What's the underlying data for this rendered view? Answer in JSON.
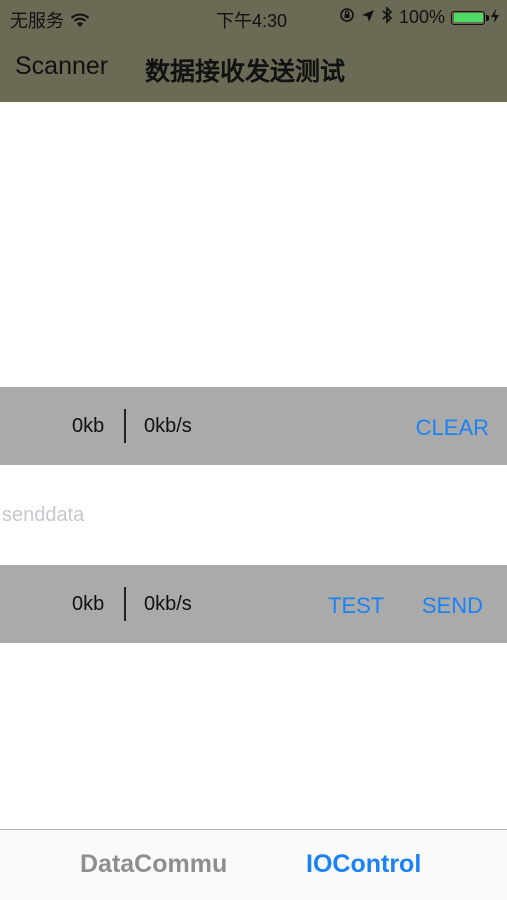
{
  "status_bar": {
    "carrier": "无服务",
    "time": "下午4:30",
    "battery_percent": "100%",
    "battery_level": 1.0,
    "icons": [
      "wifi-icon",
      "orientation-lock-icon",
      "location-icon",
      "bluetooth-icon",
      "battery-icon",
      "charging-icon"
    ]
  },
  "navbar": {
    "left_label": "Scanner",
    "title": "数据接收发送测试"
  },
  "receive_bar": {
    "size": "0kb",
    "rate": "0kb/s",
    "clear_label": "CLEAR"
  },
  "send_input": {
    "value": "",
    "placeholder": "senddata"
  },
  "send_bar": {
    "size": "0kb",
    "rate": "0kb/s",
    "test_label": "TEST",
    "send_label": "SEND"
  },
  "tabbar": {
    "tabs": [
      {
        "label": "DataCommu",
        "selected": false
      },
      {
        "label": "IOControl",
        "selected": true
      }
    ]
  },
  "colors": {
    "nav_background": "#6b6a55",
    "bar_background": "#aaaaaa",
    "accent": "#1a82f7",
    "battery": "#4cd964"
  }
}
